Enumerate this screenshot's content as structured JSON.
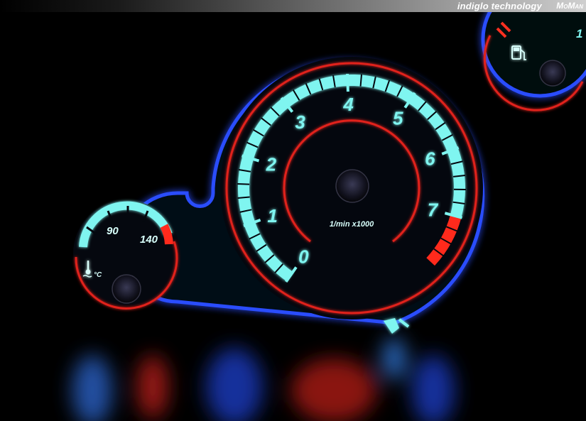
{
  "header": {
    "brand_text": "indiglo technology",
    "brand_logo": "MoMan"
  },
  "tachometer": {
    "labels": [
      "0",
      "1",
      "2",
      "3",
      "4",
      "5",
      "6",
      "7"
    ],
    "unit": "1/min x1000",
    "redline_from": 7
  },
  "temperature_gauge": {
    "labels": [
      "90",
      "140"
    ],
    "unit_label": "°C",
    "icon": "thermometer-icon"
  },
  "fuel_gauge": {
    "label_partial": "1",
    "icon": "fuel-pump-icon"
  },
  "colors": {
    "glow_cyan": "#7ff5f0",
    "ring_red": "#e0201a",
    "edge_blue": "#2a4dff",
    "background": "#000000"
  }
}
